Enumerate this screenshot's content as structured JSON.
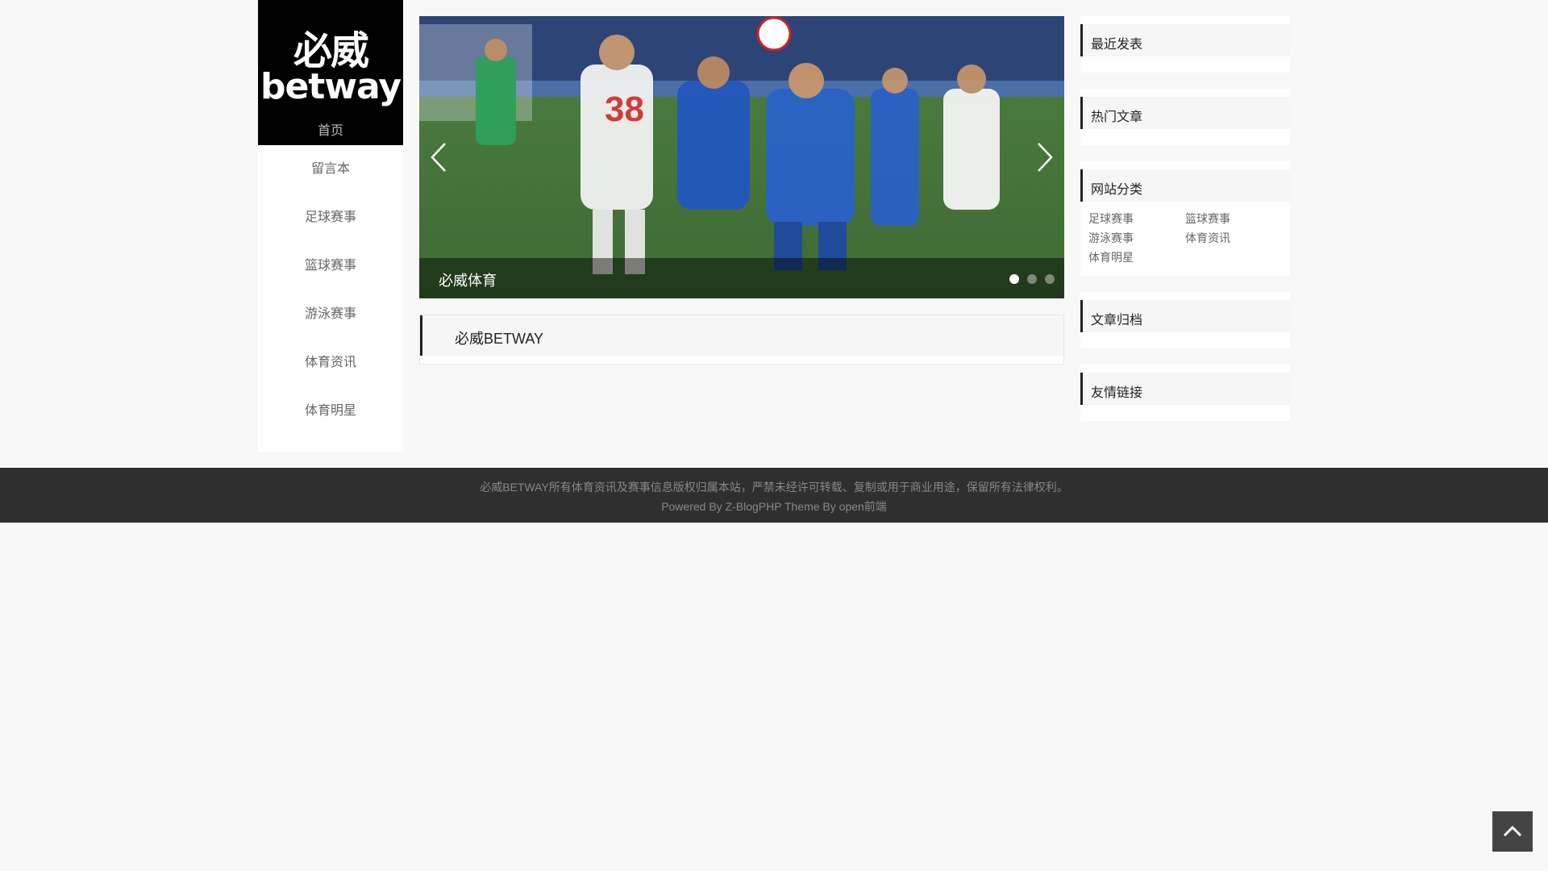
{
  "logo": {
    "cn_text": "必威",
    "en_text": "betway"
  },
  "nav": {
    "home": "首页",
    "items": [
      {
        "label": "留言本"
      },
      {
        "label": "足球赛事"
      },
      {
        "label": "篮球赛事"
      },
      {
        "label": "游泳赛事"
      },
      {
        "label": "体育资讯"
      },
      {
        "label": "体育明星"
      }
    ]
  },
  "slider": {
    "caption": "必威体育",
    "dots": 3,
    "active_index": 0
  },
  "main": {
    "site_title": "必威BETWAY"
  },
  "sidebar": {
    "recent_title": "最近发表",
    "hot_title": "热门文章",
    "category_title": "网站分类",
    "categories": [
      "足球赛事",
      "篮球赛事",
      "游泳赛事",
      "体育资讯",
      "体育明星"
    ],
    "archive_title": "文章归档",
    "links_title": "友情链接"
  },
  "footer": {
    "copyright": "必威BETWAY所有体育资讯及赛事信息版权归属本站，严禁未经许可转载、复制或用于商业用途，保留所有法律权利。",
    "powered": "Powered By Z-BlogPHP Theme By open前端"
  },
  "icons": {
    "back_to_top": "chevron-up-icon",
    "prev": "chevron-left-icon",
    "next": "chevron-right-icon"
  },
  "colors": {
    "logo_bg": "#000000",
    "footer_bg": "#2f2f2f",
    "page_bg": "#f8f8f8"
  }
}
